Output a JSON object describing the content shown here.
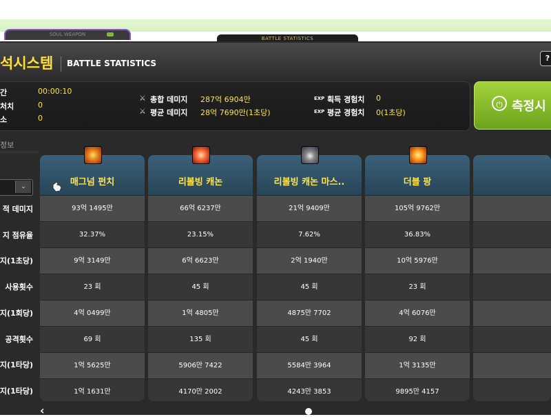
{
  "tabs": {
    "left": "SOUL WEAPON",
    "center": "BATTLE STATISTICS"
  },
  "header": {
    "title_ko": "석시스템",
    "title_en": "BATTLE STATISTICS",
    "help": "?"
  },
  "summary": {
    "left_labels": [
      "간",
      "처치",
      "소"
    ],
    "left_values": [
      "00:00:10",
      "0",
      "0"
    ],
    "total_damage_label": "총합 데미지",
    "total_damage_value": "287억 6904만",
    "avg_damage_label": "평균 데미지",
    "avg_damage_value": "28억 7690만(1초당)",
    "exp_tag": "EXP",
    "gained_exp_label": "획득 경험치",
    "gained_exp_value": "0",
    "avg_exp_label": "평균 경험치",
    "avg_exp_value": "0(1초당)"
  },
  "measure_button": {
    "label": "측정시"
  },
  "section_label": "정보",
  "row_labels": [
    "적 데미지",
    "지 점유율",
    "지(1초당)",
    "사용횟수",
    "지(1회당)",
    "공격횟수",
    "지(1타당)",
    "지(1타당)"
  ],
  "columns": [
    {
      "name": "매그넘 펀치",
      "values": [
        "93억 1495만",
        "32.37%",
        "9억 3149만",
        "23 회",
        "4억 0499만",
        "69 회",
        "1억 5625만",
        "1억 1631만"
      ]
    },
    {
      "name": "리볼빙 캐논",
      "values": [
        "66억 6237만",
        "23.15%",
        "6억 6623만",
        "45 회",
        "1억 4805만",
        "135 회",
        "5906만 7422",
        "4170만 2002"
      ]
    },
    {
      "name": "리볼빙 캐논 마스..",
      "values": [
        "21억 9409만",
        "7.62%",
        "2억 1940만",
        "45 회",
        "4875만 7702",
        "45 회",
        "5584만 3964",
        "4243만 3853"
      ]
    },
    {
      "name": "더블 팡",
      "values": [
        "105억 9762만",
        "36.83%",
        "10억 5976만",
        "23 회",
        "4억 6076만",
        "92 회",
        "1억 3135만",
        "9895만 4157"
      ]
    },
    {
      "name": "",
      "values": [
        "",
        "",
        "",
        "",
        "",
        "",
        "",
        ""
      ]
    }
  ],
  "icons": [
    "soul-weapon-icon",
    "magnum-punch-icon",
    "revolving-cannon-icon",
    "revolving-cannon-mastery-icon",
    "double-fang-icon"
  ]
}
